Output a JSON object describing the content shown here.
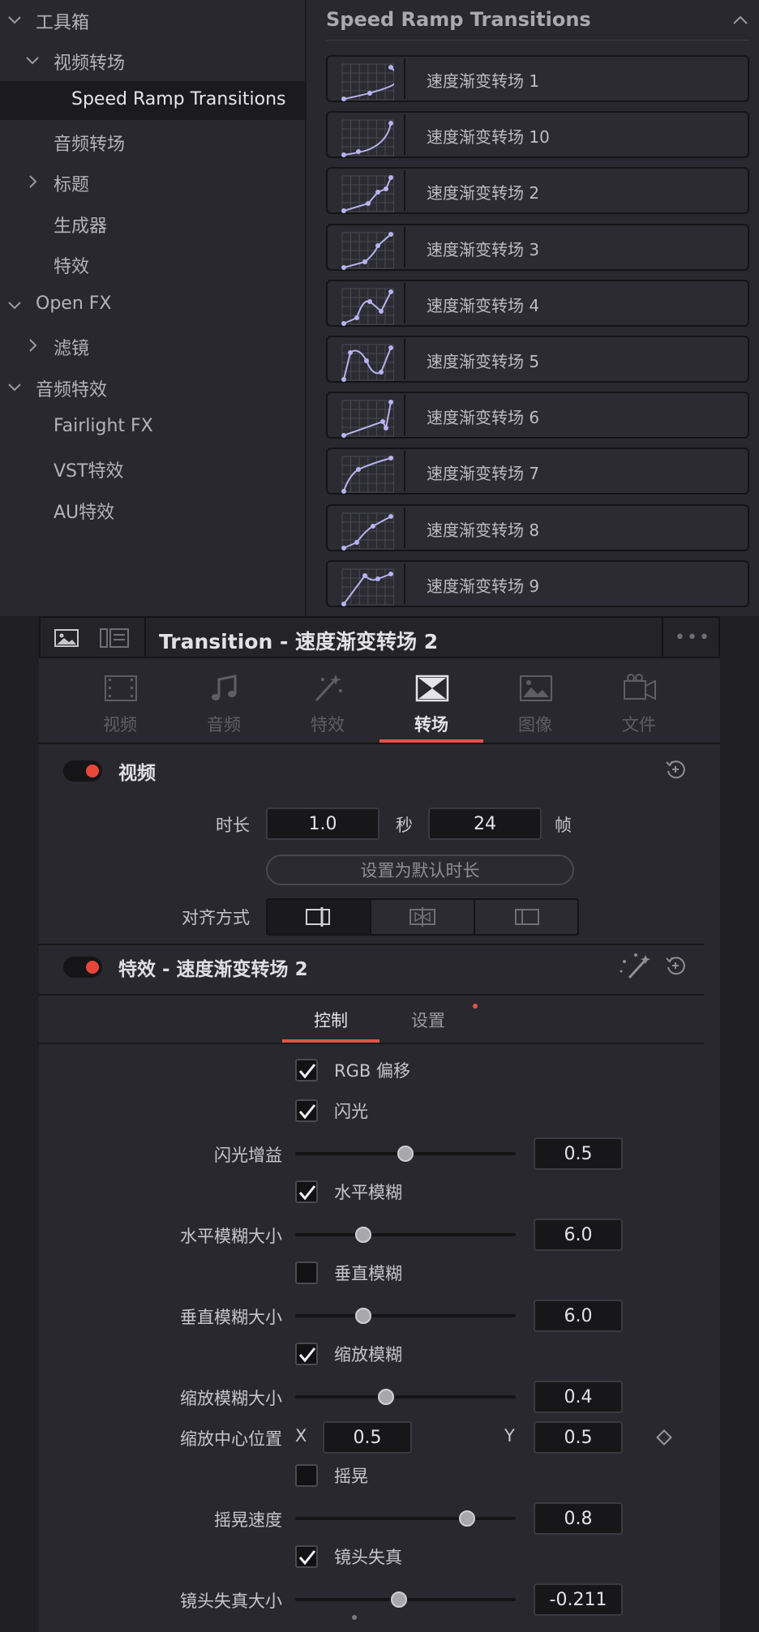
{
  "tree": {
    "items": [
      {
        "label": "工具箱",
        "chevron": "down"
      },
      {
        "label": "视频转场",
        "chevron": "down"
      },
      {
        "label": "Speed Ramp Transitions",
        "chevron": "",
        "selected": true
      },
      {
        "label": "音频转场",
        "chevron": ""
      },
      {
        "label": "标题",
        "chevron": "right"
      },
      {
        "label": "生成器",
        "chevron": ""
      },
      {
        "label": "特效",
        "chevron": ""
      },
      {
        "label": "Open FX",
        "chevron": "down"
      },
      {
        "label": "滤镜",
        "chevron": "right"
      },
      {
        "label": "音频特效",
        "chevron": "down"
      },
      {
        "label": "Fairlight FX",
        "chevron": ""
      },
      {
        "label": "VST特效",
        "chevron": ""
      },
      {
        "label": "AU特效",
        "chevron": ""
      }
    ]
  },
  "list": {
    "title": "Speed Ramp Transitions",
    "items": [
      {
        "label": "速度渐变转场 1"
      },
      {
        "label": "速度渐变转场 10"
      },
      {
        "label": "速度渐变转场 2"
      },
      {
        "label": "速度渐变转场 3"
      },
      {
        "label": "速度渐变转场 4"
      },
      {
        "label": "速度渐变转场 5"
      },
      {
        "label": "速度渐变转场 6"
      },
      {
        "label": "速度渐变转场 7"
      },
      {
        "label": "速度渐变转场 8"
      },
      {
        "label": "速度渐变转场 9"
      }
    ]
  },
  "inspector": {
    "title": "Transition - 速度渐变转场 2",
    "more": "•••",
    "tabs": [
      {
        "label": "视频",
        "icon": "film-icon"
      },
      {
        "label": "音频",
        "icon": "music-note-icon"
      },
      {
        "label": "特效",
        "icon": "magic-wand-icon"
      },
      {
        "label": "转场",
        "icon": "transition-icon",
        "active": true
      },
      {
        "label": "图像",
        "icon": "image-icon"
      },
      {
        "label": "文件",
        "icon": "file-camera-icon"
      }
    ],
    "video_section": {
      "title": "视频",
      "duration_label": "时长",
      "duration_seconds": "1.0",
      "seconds_unit": "秒",
      "duration_frames": "24",
      "frames_unit": "帧",
      "default_button": "设置为默认时长",
      "alignment_label": "对齐方式"
    },
    "effect_section": {
      "title": "特效 - 速度渐变转场 2",
      "subtabs": [
        "控制",
        "设置"
      ],
      "controls": {
        "rgb_shift": {
          "label": "RGB 偏移",
          "checked": true
        },
        "flash": {
          "label": "闪光",
          "checked": true
        },
        "flash_gain": {
          "label": "闪光增益",
          "value": "0.5",
          "pos": 0.5
        },
        "h_blur": {
          "label": "水平模糊",
          "checked": true
        },
        "h_blur_size": {
          "label": "水平模糊大小",
          "value": "6.0",
          "pos": 0.31
        },
        "v_blur": {
          "label": "垂直模糊",
          "checked": false
        },
        "v_blur_size": {
          "label": "垂直模糊大小",
          "value": "6.0",
          "pos": 0.31
        },
        "zoom_blur": {
          "label": "缩放模糊",
          "checked": true
        },
        "zoom_blur_size": {
          "label": "缩放模糊大小",
          "value": "0.4",
          "pos": 0.41
        },
        "zoom_center": {
          "label": "缩放中心位置",
          "x_label": "X",
          "x": "0.5",
          "y_label": "Y",
          "y": "0.5"
        },
        "shake": {
          "label": "摇晃",
          "checked": false
        },
        "shake_speed": {
          "label": "摇晃速度",
          "value": "0.8",
          "pos": 0.78
        },
        "lens_distort": {
          "label": "镜头失真",
          "checked": true
        },
        "lens_distort_size": {
          "label": "镜头失真大小",
          "value": "-0.211",
          "pos": 0.47
        }
      }
    }
  },
  "colors": {
    "accent": "#e0544a",
    "toggle_dot": "#e8463a",
    "curve": "#b7b3f0"
  }
}
